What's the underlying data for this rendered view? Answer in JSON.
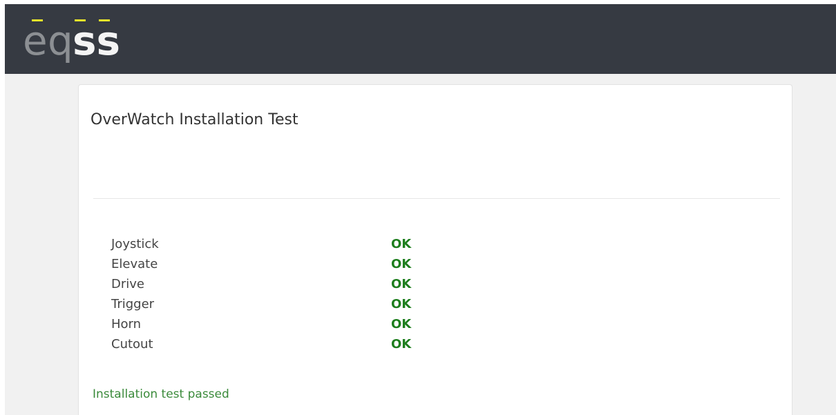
{
  "app": {
    "brand": "eqss",
    "brand_color": "#e8e42a",
    "header_color": "#363a42"
  },
  "card": {
    "title": "OverWatch Installation Test"
  },
  "results": [
    {
      "label": "Joystick",
      "status": "OK"
    },
    {
      "label": "Elevate",
      "status": "OK"
    },
    {
      "label": "Drive",
      "status": "OK"
    },
    {
      "label": "Trigger",
      "status": "OK"
    },
    {
      "label": "Horn",
      "status": "OK"
    },
    {
      "label": "Cutout",
      "status": "OK"
    }
  ],
  "summary": {
    "text": "Installation test passed"
  },
  "colors": {
    "ok": "#1e7e1e",
    "passed": "#3a8a3a"
  }
}
